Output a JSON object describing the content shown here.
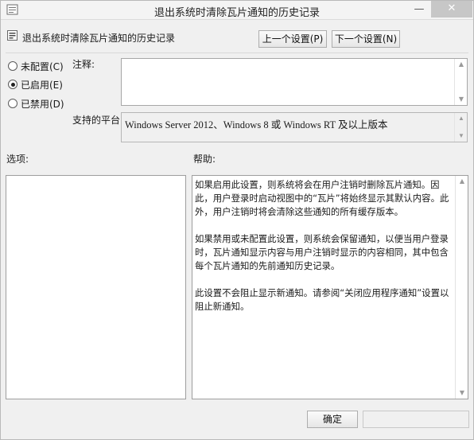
{
  "window": {
    "title": "退出系统时清除瓦片通知的历史记录",
    "min_glyph": "—",
    "close_glyph": "✕"
  },
  "header": {
    "title": "退出系统时清除瓦片通知的历史记录",
    "prev_label": "上一个设置(P)",
    "next_label": "下一个设置(N)"
  },
  "radios": [
    {
      "label": "未配置(C)",
      "checked": false
    },
    {
      "label": "已启用(E)",
      "checked": true
    },
    {
      "label": "已禁用(D)",
      "checked": false
    }
  ],
  "comment": {
    "label": "注释:",
    "value": ""
  },
  "platform": {
    "label": "支持的平台:",
    "value": "Windows Server 2012、Windows 8 或 Windows RT 及以上版本"
  },
  "options": {
    "label": "选项:"
  },
  "help": {
    "label": "帮助:",
    "paragraphs": [
      "如果启用此设置，则系统将会在用户注销时删除瓦片通知。因此，用户登录时启动视图中的“瓦片”将始终显示其默认内容。此外，用户注销时将会清除这些通知的所有缓存版本。",
      "如果禁用或未配置此设置，则系统会保留通知，以便当用户登录时，瓦片通知显示内容与用户注销时显示的内容相同，其中包含每个瓦片通知的先前通知历史记录。",
      "此设置不会阻止显示新通知。请参阅“关闭应用程序通知”设置以阻止新通知。"
    ]
  },
  "footer": {
    "ok_label": "确定",
    "cancel_label": ""
  },
  "icons": {
    "app": "policy-icon",
    "setting": "setting-icon"
  }
}
